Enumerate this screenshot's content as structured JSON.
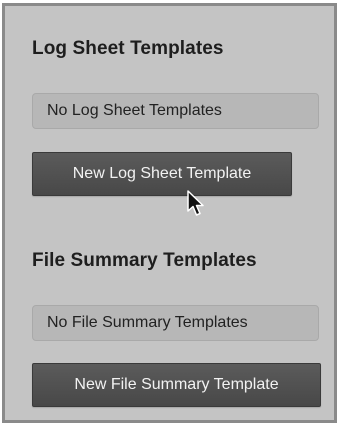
{
  "log_sheet": {
    "title": "Log Sheet Templates",
    "empty_text": "No Log Sheet Templates",
    "new_button_label": "New Log Sheet Template"
  },
  "file_summary": {
    "title": "File Summary Templates",
    "empty_text": "No File Summary Templates",
    "new_button_label": "New File Summary Template"
  },
  "icons": {
    "cursor": "arrow-pointer-icon"
  },
  "colors": {
    "panel_bg": "#c4c4c4",
    "panel_border": "#8a8a8a",
    "button_bg": "#505050",
    "empty_box_bg": "#b7b7b7"
  }
}
